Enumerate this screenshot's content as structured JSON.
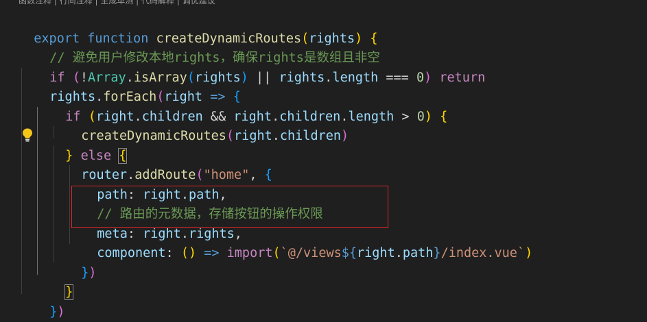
{
  "codelens": {
    "text": "函数注释 | 行间注释 | 生成单测 | 代码解释 | 调优建议"
  },
  "code": {
    "l1": {
      "export": "export",
      "function": "function",
      "name": "createDynamicRoutes",
      "open": "(",
      "param": "rights",
      "close": ")",
      "brace": "{"
    },
    "l2": {
      "comment": "// 避免用户修改本地rights，确保rights是数组且非空"
    },
    "l3": {
      "if": "if",
      "p1": "(",
      "not": "!",
      "arr": "Array",
      "dot1": ".",
      "isArray": "isArray",
      "p2": "(",
      "rights": "rights",
      "p3": ")",
      "or": " || ",
      "rights2": "rights",
      "dot2": ".",
      "length": "length",
      "eq": " === ",
      "zero": "0",
      "p4": ")",
      "ret": "return"
    },
    "l4": {
      "rights": "rights",
      "dot": ".",
      "forEach": "forEach",
      "p1": "(",
      "right": "right",
      "arrow": " => ",
      "brace": "{"
    },
    "l5": {
      "if": "if",
      "p1": "(",
      "right1": "right",
      "dot1": ".",
      "children1": "children",
      "and": " && ",
      "right2": "right",
      "dot2": ".",
      "children2": "children",
      "dot3": ".",
      "length": "length",
      "gt": " > ",
      "zero": "0",
      "p2": ")",
      "brace": "{"
    },
    "l6": {
      "fn": "createDynamicRoutes",
      "p1": "(",
      "right": "right",
      "dot": ".",
      "children": "children",
      "p2": ")"
    },
    "l7": {
      "brace": "}",
      "else": "else",
      "brace2": "{"
    },
    "l8": {
      "router": "router",
      "dot": ".",
      "addRoute": "addRoute",
      "p1": "(",
      "str": "\"home\"",
      "comma": ", ",
      "brace": "{"
    },
    "l9": {
      "key": "path",
      "colon": ": ",
      "right": "right",
      "dot": ".",
      "path": "path",
      "comma": ","
    },
    "l10": {
      "comment": "// 路由的元数据，存储按钮的操作权限"
    },
    "l11": {
      "key": "meta",
      "colon": ": ",
      "right": "right",
      "dot": ".",
      "rights": "rights",
      "comma": ","
    },
    "l12": {
      "key": "component",
      "colon": ": ",
      "p1": "(",
      "p2": ")",
      "arrow": " => ",
      "import": "import",
      "p3": "(",
      "tplstart": "`@/views",
      "dollar": "${",
      "right": "right",
      "dot": ".",
      "path": "path",
      "tclose": "}",
      "tplend": "/index.vue`",
      "p4": ")"
    },
    "l13": {
      "brace": "}",
      "p": ")"
    },
    "l14": {
      "brace": "}"
    },
    "l15": {
      "brace": "}",
      "p": ")"
    }
  },
  "colors": {
    "background": "#1f1f1f",
    "keyword": "#569cd6",
    "control": "#c586c0",
    "function": "#dcdcaa",
    "variable": "#9cdcfe",
    "class": "#4ec9b0",
    "number": "#b5cea8",
    "string": "#ce9178",
    "comment": "#6a9955",
    "highlight_box": "#e02828",
    "lightbulb": "#f5c518"
  },
  "icons": {
    "lightbulb": "lightbulb-icon"
  }
}
